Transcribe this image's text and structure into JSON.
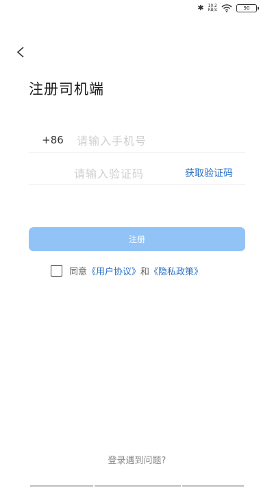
{
  "status_bar": {
    "bluetooth_icon": "bluetooth-icon",
    "speed_value": "10.2",
    "speed_unit": "KB/s",
    "wifi_icon": "wifi-icon",
    "battery": "90"
  },
  "header": {
    "back_icon": "chevron-left-icon",
    "title": "注册司机端"
  },
  "form": {
    "country_code": "+86",
    "phone_placeholder": "请输入手机号",
    "code_placeholder": "请输入验证码",
    "get_code_label": "获取验证码",
    "register_label": "注册",
    "register_color": "#92c3f6"
  },
  "agreement": {
    "checked": false,
    "prefix": "同意",
    "user_agreement": "《用户协议》",
    "and": "和",
    "privacy_policy": "《隐私政策》",
    "link_color": "#2b72c8"
  },
  "footer": {
    "problem_label": "登录遇到问题?"
  }
}
